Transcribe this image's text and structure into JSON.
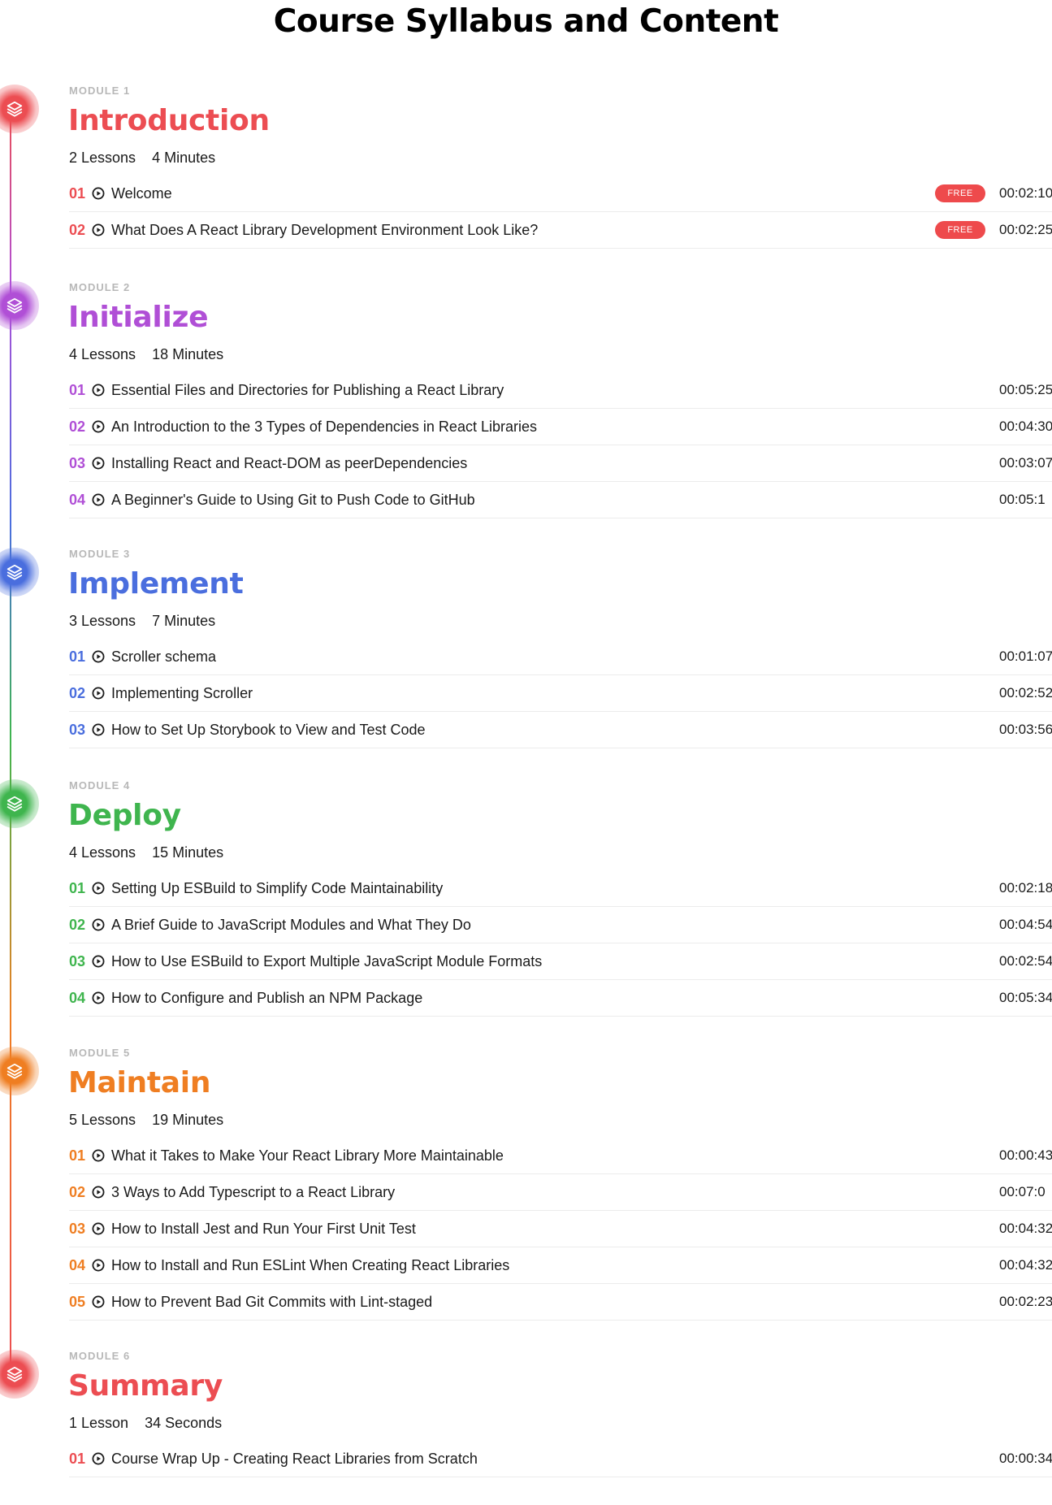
{
  "page": {
    "title": "Course Syllabus and Content",
    "free_label": "FREE"
  },
  "icons": {
    "module_icon": "layers-icon",
    "lesson_icon": "play-circle-icon"
  },
  "modules": [
    {
      "kicker": "MODULE 1",
      "title": "Introduction",
      "lessons_count": "2 Lessons",
      "duration": "4 Minutes",
      "color": "#ec4d52",
      "lessons": [
        {
          "num": "01",
          "title": "Welcome",
          "duration": "00:02:10",
          "free": true
        },
        {
          "num": "02",
          "title": "What Does A React Library Development Environment Look Like?",
          "duration": "00:02:25",
          "free": true
        }
      ]
    },
    {
      "kicker": "MODULE 2",
      "title": "Initialize",
      "lessons_count": "4 Lessons",
      "duration": "18 Minutes",
      "color": "#b04fd6",
      "lessons": [
        {
          "num": "01",
          "title": "Essential Files and Directories for Publishing a React Library",
          "duration": "00:05:25",
          "free": false
        },
        {
          "num": "02",
          "title": "An Introduction to the 3 Types of Dependencies in React Libraries",
          "duration": "00:04:30",
          "free": false
        },
        {
          "num": "03",
          "title": "Installing React and React-DOM as peerDependencies",
          "duration": "00:03:07",
          "free": false
        },
        {
          "num": "04",
          "title": "A Beginner's Guide to Using Git to Push Code to GitHub",
          "duration": "00:05:1",
          "free": false
        }
      ]
    },
    {
      "kicker": "MODULE 3",
      "title": "Implement",
      "lessons_count": "3 Lessons",
      "duration": "7 Minutes",
      "color": "#4a6ede",
      "lessons": [
        {
          "num": "01",
          "title": "Scroller schema",
          "duration": "00:01:07",
          "free": false
        },
        {
          "num": "02",
          "title": "Implementing Scroller",
          "duration": "00:02:52",
          "free": false
        },
        {
          "num": "03",
          "title": "How to Set Up Storybook to View and Test Code",
          "duration": "00:03:56",
          "free": false
        }
      ]
    },
    {
      "kicker": "MODULE 4",
      "title": "Deploy",
      "lessons_count": "4 Lessons",
      "duration": "15 Minutes",
      "color": "#3fb54e",
      "lessons": [
        {
          "num": "01",
          "title": "Setting Up ESBuild to Simplify Code Maintainability",
          "duration": "00:02:18",
          "free": false
        },
        {
          "num": "02",
          "title": "A Brief Guide to JavaScript Modules and What They Do",
          "duration": "00:04:54",
          "free": false
        },
        {
          "num": "03",
          "title": "How to Use ESBuild to Export Multiple JavaScript Module Formats",
          "duration": "00:02:54",
          "free": false
        },
        {
          "num": "04",
          "title": "How to Configure and Publish an NPM Package",
          "duration": "00:05:34",
          "free": false
        }
      ]
    },
    {
      "kicker": "MODULE 5",
      "title": "Maintain",
      "lessons_count": "5 Lessons",
      "duration": "19 Minutes",
      "color": "#ef7e22",
      "lessons": [
        {
          "num": "01",
          "title": "What it Takes to Make Your React Library More Maintainable",
          "duration": "00:00:43",
          "free": false
        },
        {
          "num": "02",
          "title": "3 Ways to Add Typescript to a React Library",
          "duration": "00:07:0",
          "free": false
        },
        {
          "num": "03",
          "title": "How to Install Jest and Run Your First Unit Test",
          "duration": "00:04:32",
          "free": false
        },
        {
          "num": "04",
          "title": "How to Install and Run ESLint When Creating React Libraries",
          "duration": "00:04:32",
          "free": false
        },
        {
          "num": "05",
          "title": "How to Prevent Bad Git Commits with Lint-staged",
          "duration": "00:02:23",
          "free": false
        }
      ]
    },
    {
      "kicker": "MODULE 6",
      "title": "Summary",
      "lessons_count": "1 Lesson",
      "duration": "34 Seconds",
      "color": "#ec4d52",
      "lessons": [
        {
          "num": "01",
          "title": "Course Wrap Up - Creating React Libraries from Scratch",
          "duration": "00:00:34",
          "free": false
        }
      ]
    }
  ]
}
